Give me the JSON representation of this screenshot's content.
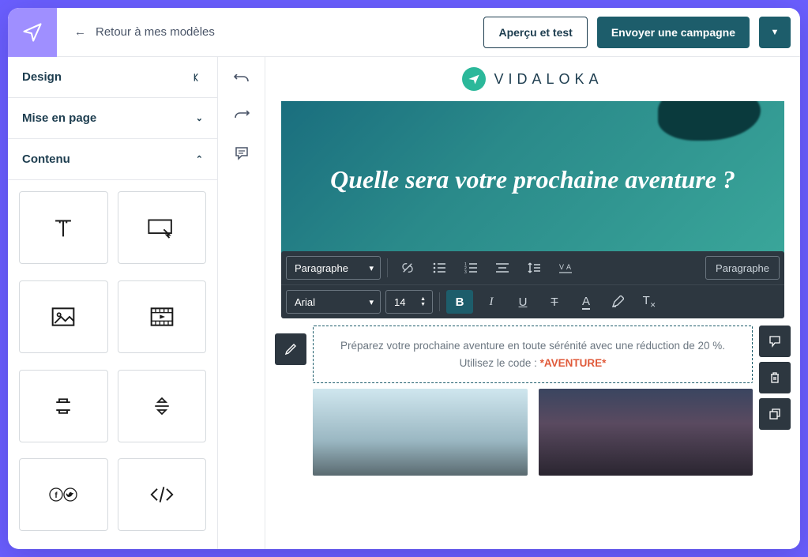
{
  "header": {
    "back_label": "Retour à mes modèles",
    "preview_label": "Aperçu et test",
    "send_label": "Envoyer une campagne"
  },
  "sidebar": {
    "sections": {
      "design": "Design",
      "layout": "Mise en page",
      "content": "Contenu"
    }
  },
  "canvas": {
    "brand_name": "VIDALOKA",
    "hero_title": "Quelle sera votre prochaine aventure ?"
  },
  "editor": {
    "style_dropdown": "Paragraphe",
    "paragraph_button": "Paragraphe",
    "font": "Arial",
    "font_size": "14"
  },
  "content": {
    "paragraph_line1": "Préparez votre prochaine aventure en toute sérénité avec une réduction de 20 %.",
    "paragraph_line2_prefix": "Utilisez le code : ",
    "paragraph_code": "*AVENTURE*"
  }
}
